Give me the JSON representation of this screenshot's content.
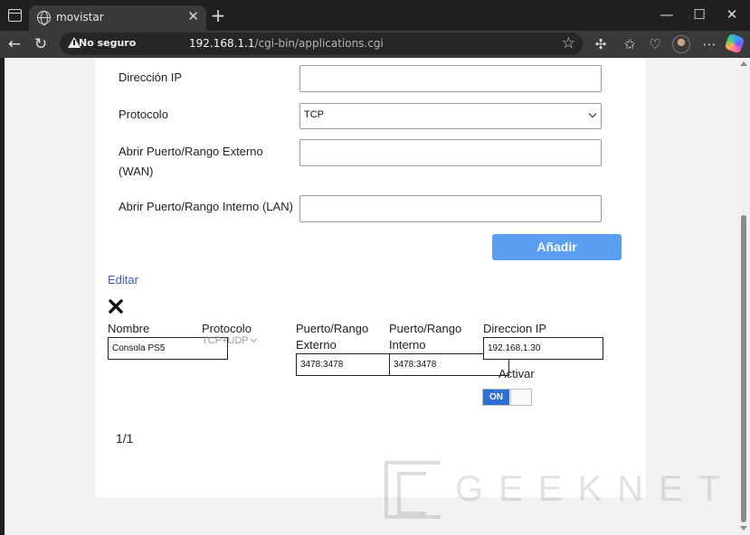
{
  "browser": {
    "tab_title": "movistar",
    "security_label": "No seguro",
    "url_host": "192.168.1.1",
    "url_path": "/cgi-bin/applications.cgi"
  },
  "form": {
    "ip_label": "Dirección IP",
    "ip_value": "",
    "protocol_label": "Protocolo",
    "protocol_value": "TCP",
    "external_label_line1": "Abrir Puerto/Rango Externo",
    "external_label_line2": "(WAN)",
    "external_value": "",
    "internal_label": "Abrir Puerto/Rango Interno (LAN)",
    "internal_value": "",
    "add_button": "Añadir"
  },
  "rules": {
    "edit_link": "Editar",
    "headers": {
      "name": "Nombre",
      "protocol": "Protocolo",
      "external_line1": "Puerto/Rango",
      "external_line2": "Externo",
      "internal_line1": "Puerto/Rango",
      "internal_line2": "Interno",
      "ip": "Direccion IP",
      "activate": "Activar"
    },
    "row": {
      "name": "Consola PS5",
      "protocol": "TCP+UDP",
      "external": "3478:3478",
      "internal": "3478:3478",
      "ip": "192.168.1.30",
      "toggle_label": "ON",
      "active": true
    },
    "pagination": "1/1"
  },
  "watermark": "GEEKNETIC",
  "colors": {
    "accent_button": "#5b9ff0",
    "link": "#3d5db8",
    "toggle_on": "#2f6fd6"
  }
}
